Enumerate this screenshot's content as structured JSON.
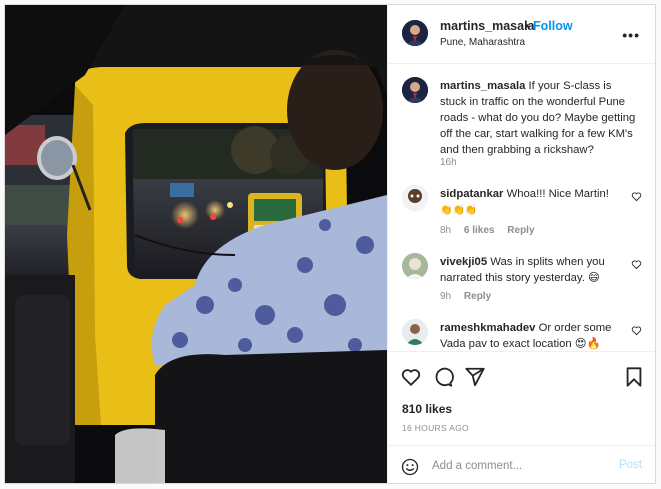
{
  "header": {
    "username": "martins_masala",
    "separator": "•",
    "follow_label": "Follow",
    "location": "Pune, Maharashtra",
    "more_label": "•••"
  },
  "caption": {
    "username": "martins_masala",
    "text": "If your S-class is stuck in traffic on the wonderful Pune roads - what do you do? Maybe getting off the car, start walking for a few KM's and then grabbing a rickshaw?",
    "age": "16h"
  },
  "comments": [
    {
      "username": "sidpatankar",
      "text": "Whoa!!! Nice Martin!",
      "emoji": "👏👏👏",
      "age": "8h",
      "likes": "6 likes",
      "reply": "Reply"
    },
    {
      "username": "vivekji05",
      "text": "Was in splits when you narrated this story yesterday. 😄",
      "age": "9h",
      "reply": "Reply"
    },
    {
      "username": "rameshkmahadev",
      "text": "Or order some Vada pav to exact location 😍🔥"
    }
  ],
  "actions": {
    "likes": "810 likes",
    "timestamp": "16 HOURS AGO"
  },
  "add_comment": {
    "placeholder": "Add a comment...",
    "post_label": "Post"
  },
  "colors": {
    "follow": "#0095f6",
    "post_disabled": "#b2dffc",
    "muted": "#8e8e8e",
    "rickshaw_yellow": "#f0c419"
  }
}
